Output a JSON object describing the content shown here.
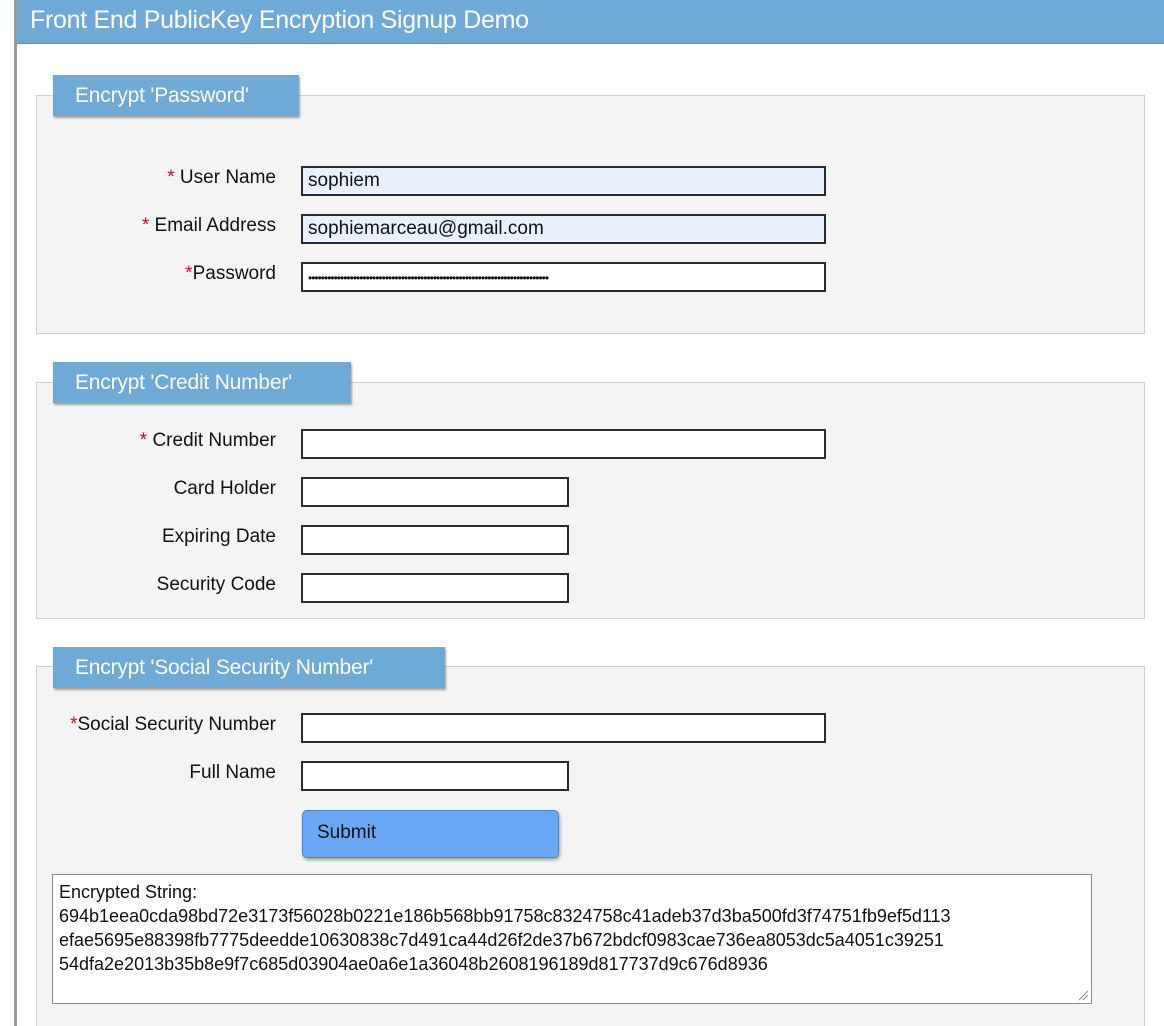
{
  "header": {
    "title": "Front End PublicKey Encryption Signup Demo"
  },
  "sections": {
    "password": {
      "legend": "Encrypt 'Password'",
      "fields": {
        "username": {
          "required_mark": "*",
          "label": " User Name",
          "value": "sophiem"
        },
        "email": {
          "required_mark": "*",
          "label": " Email Address",
          "value": "sophiemarceau@gmail.com"
        },
        "password": {
          "required_mark": "*",
          "label": "Password",
          "masked_value": "•••••••••••••••••••••••••••••••••••••••••••••••••••••••••••••••••••••••••••"
        }
      }
    },
    "credit": {
      "legend": "Encrypt 'Credit Number'",
      "fields": {
        "credit_number": {
          "required_mark": "*",
          "label": " Credit Number",
          "value": ""
        },
        "card_holder": {
          "label": "Card Holder",
          "value": ""
        },
        "expiring_date": {
          "label": "Expiring Date",
          "value": ""
        },
        "security_code": {
          "label": "Security Code",
          "value": ""
        }
      }
    },
    "ssn": {
      "legend": "Encrypt 'Social Security Number'",
      "fields": {
        "ssn": {
          "required_mark": "*",
          "label": "Social Security Number",
          "value": ""
        },
        "full_name": {
          "label": "Full Name",
          "value": ""
        }
      }
    }
  },
  "actions": {
    "submit_label": "Submit"
  },
  "output": {
    "heading": "Encrypted String:",
    "lines": [
      "694b1eea0cda98bd72e3173f56028b0221e186b568bb91758c8324758c41adeb37d3ba500fd3f74751fb9ef5d113",
      "efae5695e88398fb7775deedde10630838c7d491ca44d26f2de37b672bdcf0983cae736ea8053dc5a4051c39251",
      "54dfa2e2013b35b8e9f7c685d03904ae0a6e1a36048b2608196189d817737d9c676d8936"
    ]
  },
  "colors": {
    "header_bg": "#6fa9d6",
    "legend_bg": "#6fa9d6",
    "submit_bg": "#6aa8f5",
    "required": "#cc1111",
    "autofill_bg": "#e8f0fe"
  }
}
